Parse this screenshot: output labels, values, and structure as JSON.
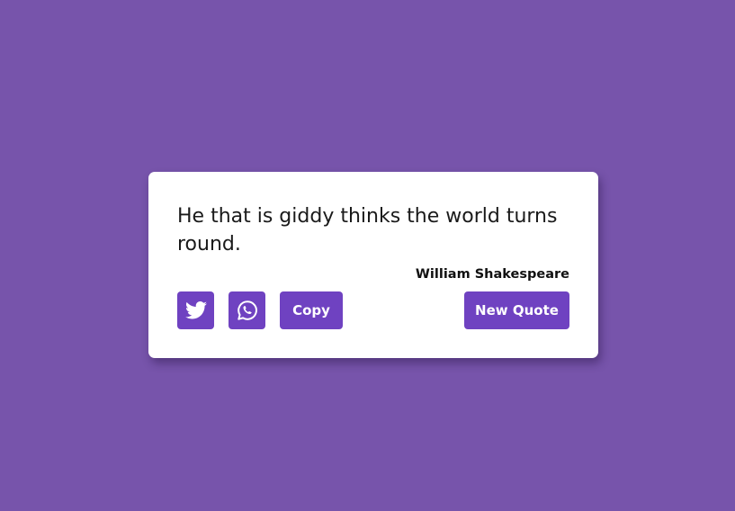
{
  "quote": {
    "text": "He that is giddy thinks the world turns round.",
    "author": "William Shakespeare"
  },
  "actions": {
    "twitter_icon": "twitter-icon",
    "whatsapp_icon": "whatsapp-icon",
    "copy_label": "Copy",
    "new_quote_label": "New Quote"
  },
  "colors": {
    "background": "#7754ab",
    "card": "#ffffff",
    "button": "#6f42c1",
    "button_text": "#ffffff"
  }
}
